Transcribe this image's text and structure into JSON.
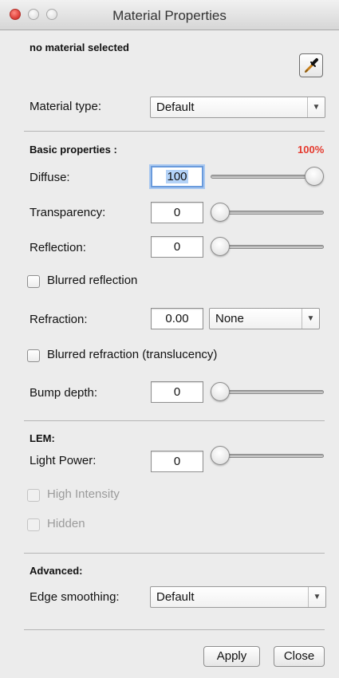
{
  "window": {
    "title": "Material Properties"
  },
  "status": {
    "selection_text": "no material selected"
  },
  "toolbar": {
    "picker_icon": "eyedropper-icon"
  },
  "material_type": {
    "label": "Material type:",
    "value": "Default"
  },
  "basic": {
    "header": "Basic properties :",
    "percent": "100%",
    "percent_color": "#e53a2e",
    "diffuse": {
      "label": "Diffuse:",
      "value": "100",
      "slider_fraction": 1.0
    },
    "transparency": {
      "label": "Transparency:",
      "value": "0",
      "slider_fraction": 0.0
    },
    "reflection": {
      "label": "Reflection:",
      "value": "0",
      "slider_fraction": 0.0
    },
    "blurred_reflection": {
      "label": "Blurred reflection",
      "checked": false
    },
    "refraction": {
      "label": "Refraction:",
      "value": "0.00",
      "select_value": "None"
    },
    "blurred_refraction": {
      "label": "Blurred refraction (translucency)",
      "checked": false
    },
    "bump_depth": {
      "label": "Bump depth:",
      "value": "0",
      "slider_fraction": 0.0
    }
  },
  "lem": {
    "header": "LEM:",
    "light_power": {
      "label": "Light Power:",
      "value": "0",
      "slider_fraction": 0.0
    },
    "high_intensity": {
      "label": "High Intensity",
      "checked": false,
      "enabled": false
    },
    "hidden": {
      "label": "Hidden",
      "checked": false,
      "enabled": false
    }
  },
  "advanced": {
    "header": "Advanced:",
    "edge_smoothing": {
      "label": "Edge smoothing:",
      "value": "Default"
    }
  },
  "buttons": {
    "apply": "Apply",
    "close": "Close"
  }
}
